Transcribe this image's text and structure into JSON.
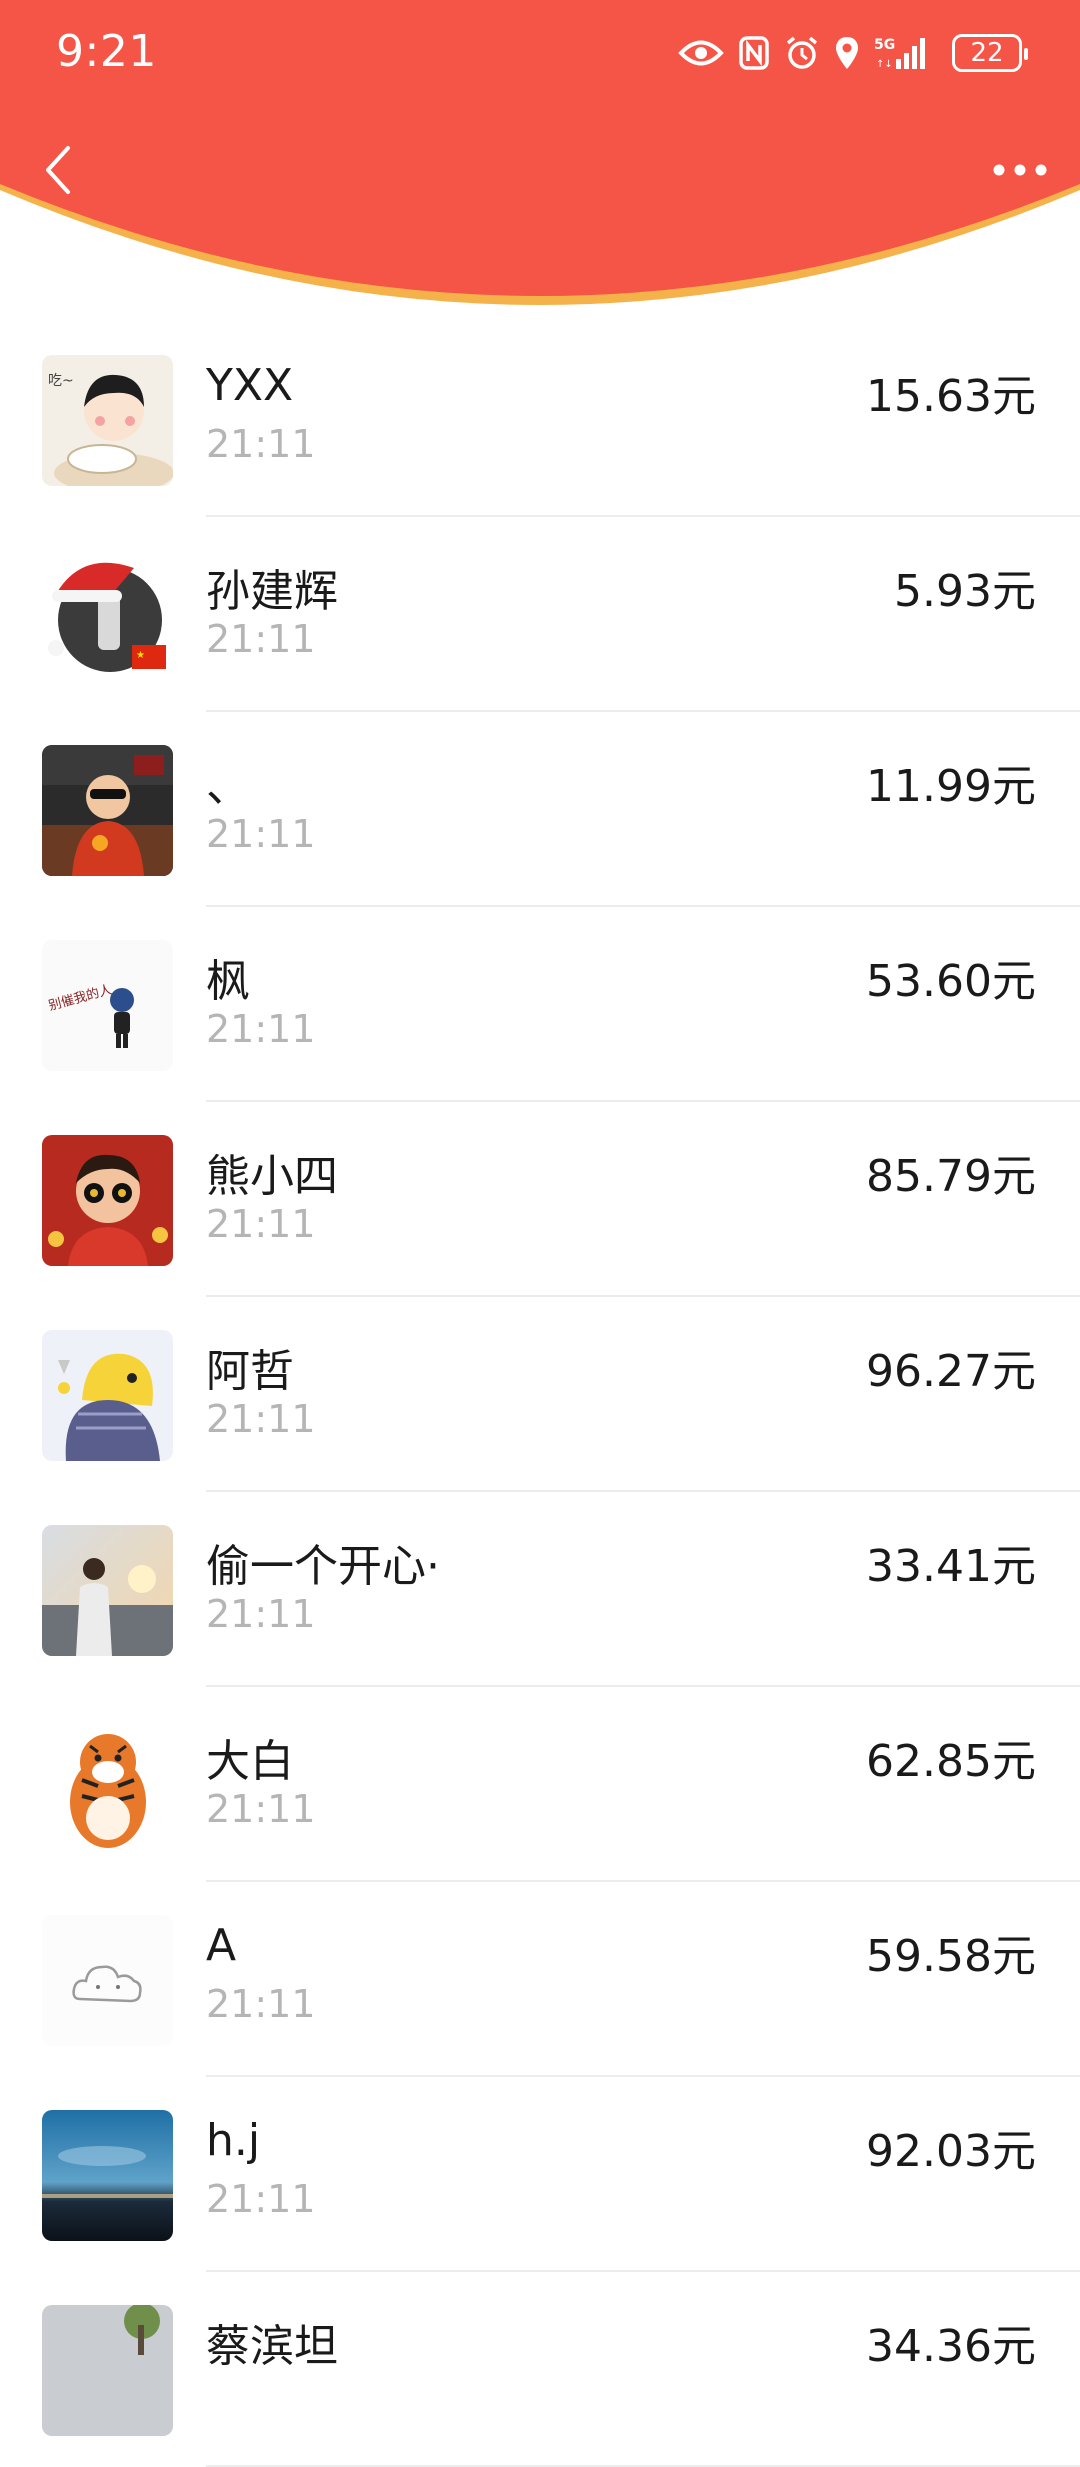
{
  "status_bar": {
    "time": "9:21",
    "battery_level": "22",
    "network": "5G"
  },
  "nav": {
    "back_icon": "chevron-left-icon",
    "more_icon": "more-horizontal-icon",
    "header_color": "#F55546"
  },
  "receipts": [
    {
      "name": "YXX",
      "time": "21:11",
      "amount": "15.63元"
    },
    {
      "name": "孙建辉",
      "time": "21:11",
      "amount": "5.93元"
    },
    {
      "name": "、",
      "time": "21:11",
      "amount": "11.99元"
    },
    {
      "name": "枫",
      "time": "21:11",
      "amount": "53.60元"
    },
    {
      "name": "熊小四",
      "time": "21:11",
      "amount": "85.79元"
    },
    {
      "name": "阿哲",
      "time": "21:11",
      "amount": "96.27元"
    },
    {
      "name": "偷一个开心·",
      "time": "21:11",
      "amount": "33.41元"
    },
    {
      "name": "大白",
      "time": "21:11",
      "amount": "62.85元"
    },
    {
      "name": "A",
      "time": "21:11",
      "amount": "59.58元"
    },
    {
      "name": "h.j",
      "time": "21:11",
      "amount": "92.03元"
    },
    {
      "name": "蔡滨坦",
      "time": "",
      "amount": "34.36元"
    }
  ]
}
